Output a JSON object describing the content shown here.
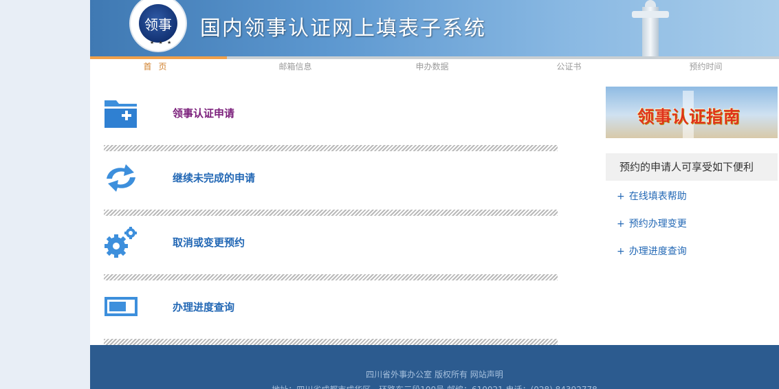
{
  "banner": {
    "title": "国内领事认证网上填表子系统",
    "emblem_glyph": "领事",
    "emblem_stars": "★ ★ ★"
  },
  "nav": {
    "items": [
      "首页",
      "邮箱信息",
      "申办数据",
      "公证书",
      "预约时间"
    ],
    "active_index": 0
  },
  "main": {
    "items": [
      {
        "label": "领事认证申请",
        "icon": "folder-add-icon"
      },
      {
        "label": "继续未完成的申请",
        "icon": "refresh-arrows-icon"
      },
      {
        "label": "取消或变更预约",
        "icon": "gears-icon"
      },
      {
        "label": "办理进度查询",
        "icon": "progress-bar-icon"
      }
    ]
  },
  "sidebar": {
    "guide_text": "领事认证指南",
    "heading": "预约的申请人可享受如下便利",
    "links": [
      "在线填表帮助",
      "预约办理变更",
      "办理进度查询"
    ],
    "plus": "+"
  },
  "footer": {
    "line1": "四川省外事办公室 版权所有 网站声明",
    "line2": "地址：四川省成都市成华区一环路东三段100号 邮编：610021 电话：(028) 84392778"
  },
  "colors": {
    "accent_blue": "#2368b5",
    "active_nav": "#d0802c",
    "footer_bg": "#2c5b8f",
    "first_link": "#7b1f7b"
  }
}
